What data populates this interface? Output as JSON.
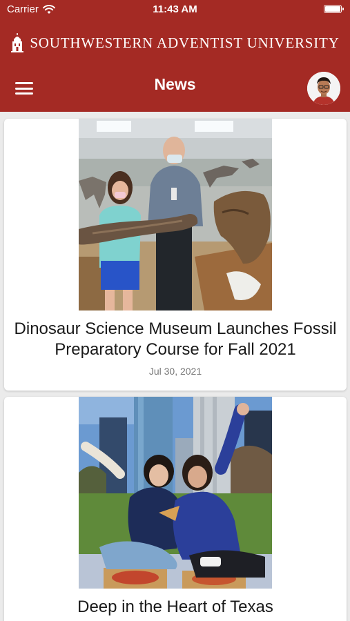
{
  "status_bar": {
    "carrier": "Carrier",
    "time": "11:43 AM",
    "wifi_icon": "wifi-icon",
    "battery_icon": "battery-icon"
  },
  "header": {
    "brand_name": "SOUTHWESTERN ADVENTIST UNIVERSITY",
    "brand_icon": "university-tower-icon",
    "title": "News",
    "menu_icon": "hamburger-menu-icon",
    "avatar_icon": "user-avatar",
    "color": "#a42a24"
  },
  "news": [
    {
      "title": "Dinosaur Science Museum Launches Fossil Preparatory Course for Fall 2021",
      "date": "Jul 30, 2021",
      "image": "museum-fossil-photo"
    },
    {
      "title": "Deep in the Heart of Texas",
      "date": "",
      "image": "students-picnic-city-photo"
    }
  ]
}
